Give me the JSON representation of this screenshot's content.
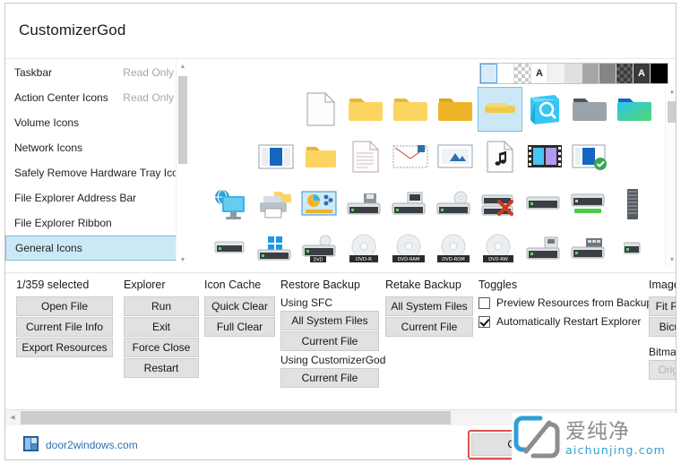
{
  "window": {
    "title": "CustomizerGod"
  },
  "resource_list": {
    "items": [
      {
        "label": "Taskbar",
        "state": "Read Only",
        "selected": false
      },
      {
        "label": "Action Center Icons",
        "state": "Read Only",
        "selected": false
      },
      {
        "label": "Volume Icons",
        "state": "",
        "selected": false
      },
      {
        "label": "Network Icons",
        "state": "",
        "selected": false
      },
      {
        "label": "Safely Remove Hardware Tray Icon",
        "state": "",
        "selected": false
      },
      {
        "label": "File Explorer Address Bar",
        "state": "",
        "selected": false
      },
      {
        "label": "File Explorer Ribbon",
        "state": "",
        "selected": false
      },
      {
        "label": "General Icons",
        "state": "",
        "selected": true
      }
    ]
  },
  "preview": {
    "background_swatches": [
      {
        "name": "light-blue-selected",
        "color": "#dbeaf7",
        "selected": true
      },
      {
        "name": "white",
        "color": "#ffffff",
        "selected": false
      },
      {
        "name": "checker-light",
        "color": "checker",
        "selected": false
      },
      {
        "name": "letter-a-white",
        "color": "#ffffff",
        "letter": "A",
        "selected": false
      },
      {
        "name": "gray-95",
        "color": "#f2f2f2",
        "selected": false
      },
      {
        "name": "gray-88",
        "color": "#e0e0e0",
        "selected": false
      },
      {
        "name": "gray-65",
        "color": "#a6a6a6",
        "selected": false
      },
      {
        "name": "gray-52",
        "color": "#858585",
        "selected": false
      },
      {
        "name": "checker-dark",
        "color": "checker-dark",
        "selected": false
      },
      {
        "name": "letter-a-dark",
        "color": "#3a3a3a",
        "letter": "A",
        "selected": false
      },
      {
        "name": "black",
        "color": "#000000",
        "selected": false
      }
    ],
    "icons": {
      "row1": [
        "blank-document-icon",
        "folder-closed-icon",
        "folder-closed-icon",
        "folder-open-icon",
        "folder-selected-icon",
        "search-folder-icon",
        "folder-gray-icon",
        "folder-green-icon"
      ],
      "row2": [
        "window-blue-icon",
        "folder-small-icon",
        "text-document-icon",
        "envelope-mail-icon",
        "image-file-icon",
        "music-note-file-icon",
        "film-strip-icon",
        "window-check-icon"
      ],
      "row3": [
        "network-computer-icon",
        "printer-folder-icon",
        "network-settings-icon",
        "drive-floppy-icon",
        "drive-server-icon",
        "drive-disc-icon",
        "drive-disconnected-icon",
        "drive-plain-icon",
        "drive-green-bar-icon",
        "memory-module-icon"
      ],
      "row4": [
        "drive-small-icon",
        "drive-windows-icon",
        "drive-dvd-icon",
        "disc-dvd-r-icon",
        "disc-dvd-ram-icon",
        "disc-dvd-rom-icon",
        "disc-dvd-rw-icon",
        "drive-backup-icon",
        "drive-rack-icon",
        "drive-edge-icon"
      ],
      "disc_labels": [
        "DVD",
        "DVD-R",
        "DVD-RAM",
        "DVD-ROM",
        "DVD-RW"
      ]
    }
  },
  "commands": {
    "selection": {
      "heading": "1/359 selected",
      "buttons": [
        "Open File",
        "Current File Info",
        "Export Resources"
      ]
    },
    "explorer": {
      "heading": "Explorer",
      "buttons": [
        "Run",
        "Exit",
        "Force Close",
        "Restart"
      ]
    },
    "icon_cache": {
      "heading": "Icon Cache",
      "buttons": [
        "Quick Clear",
        "Full Clear"
      ]
    },
    "restore_backup": {
      "heading": "Restore Backup",
      "sub_sfc": "Using SFC",
      "sfc_buttons": [
        "All System Files",
        "Current File"
      ],
      "sub_cg": "Using CustomizerGod",
      "cg_buttons": [
        "Current File"
      ]
    },
    "retake_backup": {
      "heading": "Retake Backup",
      "buttons": [
        "All System Files",
        "Current File"
      ]
    },
    "toggles": {
      "heading": "Toggles",
      "items": [
        {
          "label": "Preview Resources from Backup",
          "checked": false
        },
        {
          "label": "Automatically Restart Explorer",
          "checked": true
        }
      ]
    },
    "image_resize": {
      "heading": "Image R",
      "buttons": [
        "Fit Resiz",
        "Bicubic"
      ],
      "sub_heading": "Bitmap F",
      "disabled_button": "Original"
    }
  },
  "status_bar": {
    "site": "door2windows.com",
    "change_button": "Ch"
  },
  "watermark": {
    "cn_text": "爱纯净",
    "url_text": "aichunjing.com"
  },
  "colors": {
    "selection_blue": "#cce8f6",
    "selection_border": "#7ebde0",
    "button_face": "#e1e1e1",
    "link_blue": "#2f6fb0",
    "highlight_red": "#d9534f",
    "watermark_blue": "#2f9fd6"
  }
}
